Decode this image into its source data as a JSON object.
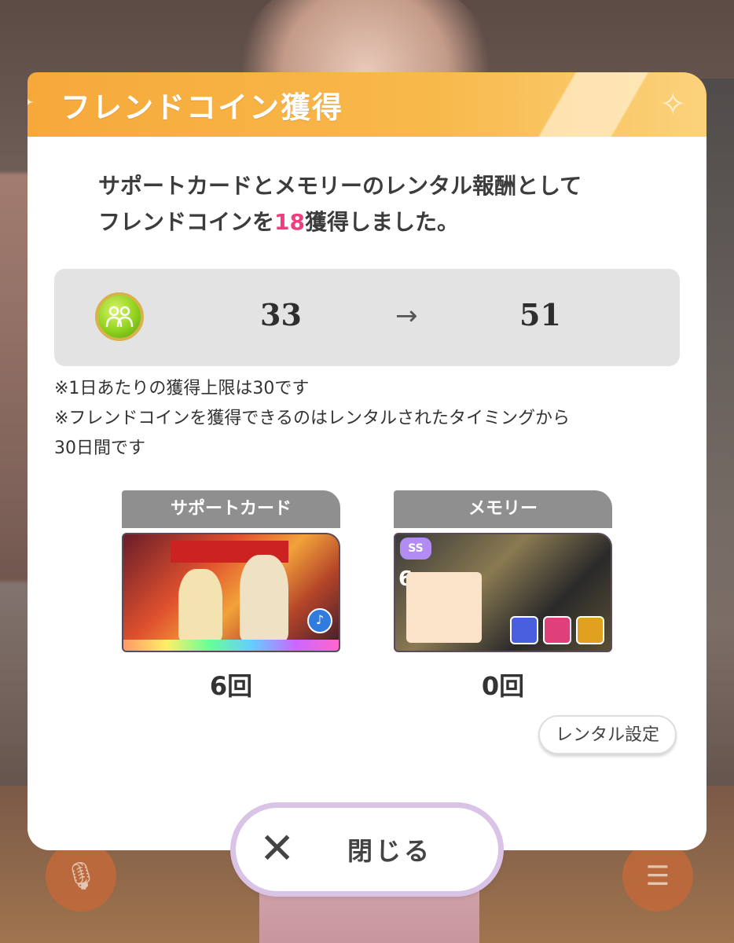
{
  "dialog": {
    "title": "フレンドコイン獲得",
    "message_line1": "サポートカードとメモリーのレンタル報酬として",
    "message_line2_prefix": "フレンドコインを",
    "message_line2_amount": "18",
    "message_line2_suffix": "獲得しました。"
  },
  "coins": {
    "icon": "friend-coin-icon",
    "from": "33",
    "arrow": "→",
    "to": "51"
  },
  "notes": {
    "line1": "※1日あたりの獲得上限は30です",
    "line2": "※フレンドコインを獲得できるのはレンタルされたタイミングから",
    "line3": "30日間です"
  },
  "cards": {
    "support": {
      "label": "サポートカード",
      "count": "6回"
    },
    "memory": {
      "label": "メモリー",
      "count": "0回"
    }
  },
  "rental_settings_label": "レンタル設定",
  "close": {
    "icon": "close-icon",
    "label": "閉じる"
  },
  "colors": {
    "header": "#f6a93a",
    "highlight": "#ef3d7f",
    "tab": "#8f8f8f"
  }
}
